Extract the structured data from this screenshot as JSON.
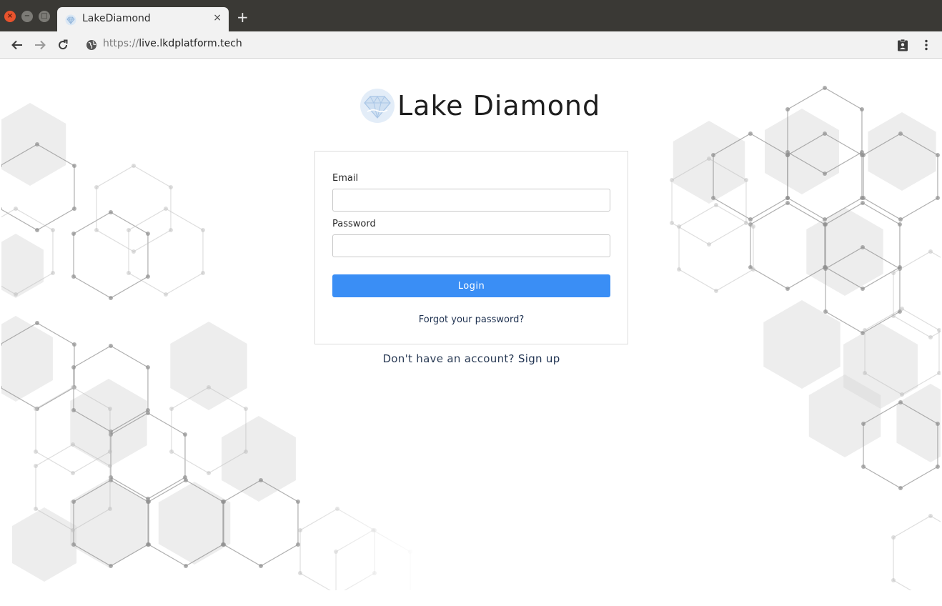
{
  "window": {
    "close_glyph": "×",
    "minimize_glyph": "−",
    "maximize_glyph": "□"
  },
  "tab": {
    "title": "LakeDiamond",
    "close_glyph": "×",
    "new_tab_glyph": "+"
  },
  "toolbar": {
    "url_scheme": "https://",
    "url_host": "live.lkdplatform.tech",
    "icons": [
      "back-arrow-icon",
      "forward-arrow-icon",
      "reload-icon",
      "globe-icon",
      "clipboard-account-icon",
      "kebab-menu-icon"
    ]
  },
  "brand": {
    "name": "Lake Diamond"
  },
  "form": {
    "email_label": "Email",
    "email_value": "",
    "password_label": "Password",
    "password_value": "",
    "login_label": "Login",
    "forgot_label": "Forgot your password?"
  },
  "signup": {
    "prefix": "Don't have an account?",
    "link": "Sign up"
  },
  "colors": {
    "accent": "#3a8ef5",
    "titlebar": "#3a3935",
    "toolbar": "#f2f2f2",
    "link": "#1e3150"
  }
}
